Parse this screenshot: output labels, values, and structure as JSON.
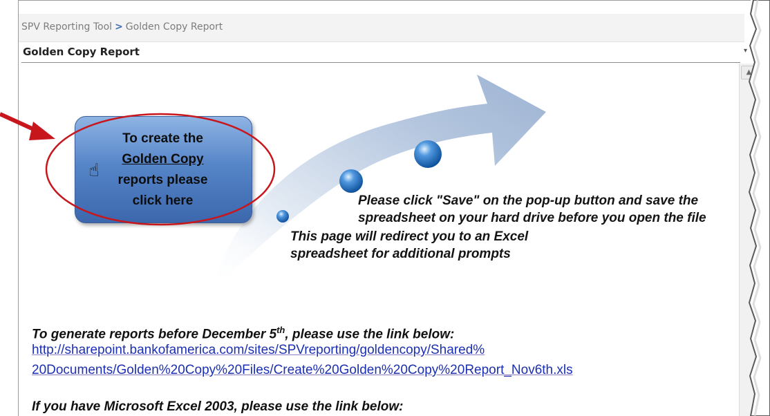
{
  "breadcrumb": {
    "root": "SPV Reporting Tool",
    "separator": ">",
    "current": "Golden Copy Report"
  },
  "page_title": "Golden Copy Report",
  "create_button": {
    "line1": "To create the",
    "link": "Golden Copy",
    "line3": "reports please",
    "line4": "click here"
  },
  "steps": {
    "step1": "This page will redirect you to an Excel spreadsheet for additional prompts",
    "step2": "Please click \"Save\" on the pop-up button and save the spreadsheet on your hard drive before you open the file"
  },
  "notes": {
    "december_prefix": "To generate reports before December 5",
    "december_sup": "th",
    "december_suffix": ", please use the link below:",
    "december_link_line1": "http://sharepoint.bankofamerica.com/sites/SPVreporting/goldencopy/Shared%",
    "december_link_line2": "20Documents/Golden%20Copy%20Files/Create%20Golden%20Copy%20Report_Nov6th.xls",
    "excel2003": "If you have Microsoft Excel 2003, please use the link below:"
  },
  "icons": {
    "hand": "hand-pointer-icon",
    "scroll_up": "scroll-up-arrow-icon"
  },
  "colors": {
    "button_blue": "#5685c8",
    "highlight_red": "#c8161d",
    "link_blue": "#1a2fb3"
  }
}
